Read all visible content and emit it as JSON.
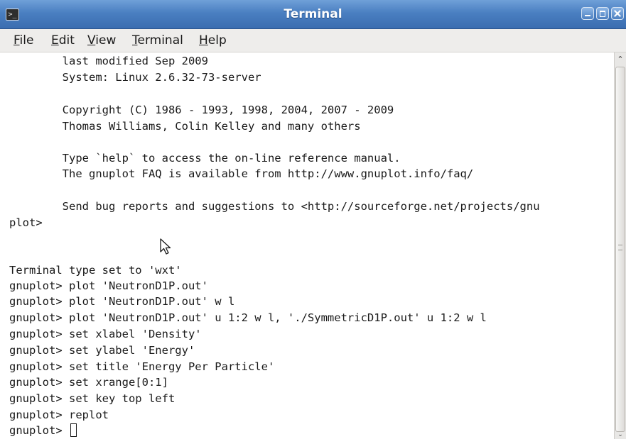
{
  "window": {
    "title": "Terminal",
    "title_icon": "terminal-icon",
    "controls": [
      "minimize-icon",
      "maximize-icon",
      "close-icon"
    ]
  },
  "menubar": {
    "items": [
      {
        "first": "F",
        "rest": "ile"
      },
      {
        "first": "E",
        "rest": "dit"
      },
      {
        "first": "V",
        "rest": "iew"
      },
      {
        "first": "T",
        "rest": "erminal"
      },
      {
        "first": "H",
        "rest": "elp"
      }
    ]
  },
  "terminal": {
    "lines": [
      "        last modified Sep 2009",
      "        System: Linux 2.6.32-73-server",
      "",
      "        Copyright (C) 1986 - 1993, 1998, 2004, 2007 - 2009",
      "        Thomas Williams, Colin Kelley and many others",
      "",
      "        Type `help` to access the on-line reference manual.",
      "        The gnuplot FAQ is available from http://www.gnuplot.info/faq/",
      "",
      "        Send bug reports and suggestions to <http://sourceforge.net/projects/gnu",
      "plot>",
      "",
      "",
      "Terminal type set to 'wxt'",
      "gnuplot> plot 'NeutronD1P.out'",
      "gnuplot> plot 'NeutronD1P.out' w l",
      "gnuplot> plot 'NeutronD1P.out' u 1:2 w l, './SymmetricD1P.out' u 1:2 w l",
      "gnuplot> set xlabel 'Density'",
      "gnuplot> set ylabel 'Energy'",
      "gnuplot> set title 'Energy Per Particle'",
      "gnuplot> set xrange[0:1]",
      "gnuplot> set key top left",
      "gnuplot> replot"
    ],
    "prompt": "gnuplot> "
  },
  "colors": {
    "titlebar": "#4a7fc1",
    "menubar": "#eeedeb",
    "terminal_bg": "#ffffff",
    "terminal_fg": "#1a1a1a"
  }
}
